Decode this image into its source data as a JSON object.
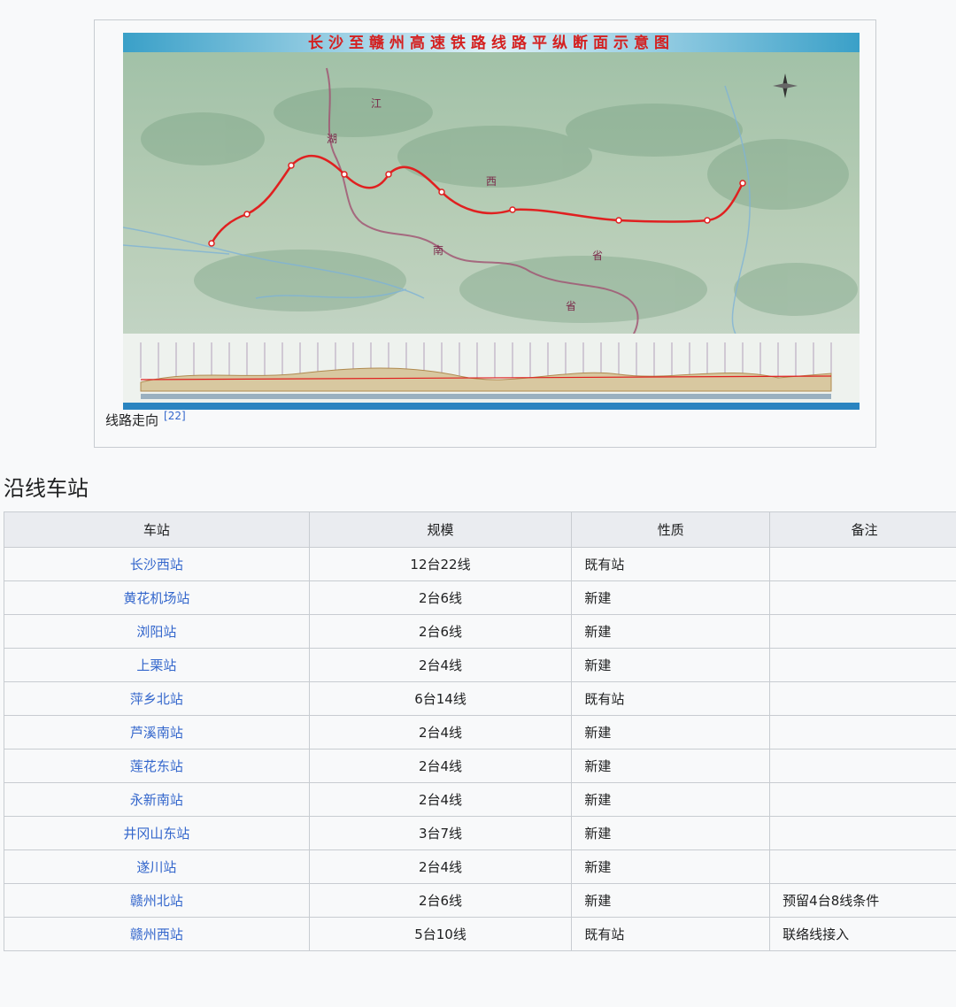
{
  "figure": {
    "map_title": "长沙至赣州高速铁路线路平纵断面示意图",
    "province_labels": [
      "江",
      "湖",
      "南",
      "西",
      "省",
      "省"
    ],
    "caption": "线路走向",
    "caption_ref": "[22]",
    "colors": {
      "route": "#e02020",
      "title": "#d42020",
      "border": "#a05070"
    }
  },
  "section": {
    "title": "沿线车站"
  },
  "table": {
    "headers": [
      "车站",
      "规模",
      "性质",
      "备注"
    ],
    "rows": [
      {
        "name": "长沙西站",
        "scale": "12台22线",
        "type": "既有站",
        "note": ""
      },
      {
        "name": "黄花机场站",
        "scale": "2台6线",
        "type": "新建",
        "note": ""
      },
      {
        "name": "浏阳站",
        "scale": "2台6线",
        "type": "新建",
        "note": ""
      },
      {
        "name": "上栗站",
        "scale": "2台4线",
        "type": "新建",
        "note": ""
      },
      {
        "name": "萍乡北站",
        "scale": "6台14线",
        "type": "既有站",
        "note": ""
      },
      {
        "name": "芦溪南站",
        "scale": "2台4线",
        "type": "新建",
        "note": ""
      },
      {
        "name": "莲花东站",
        "scale": "2台4线",
        "type": "新建",
        "note": ""
      },
      {
        "name": "永新南站",
        "scale": "2台4线",
        "type": "新建",
        "note": ""
      },
      {
        "name": "井冈山东站",
        "scale": "3台7线",
        "type": "新建",
        "note": ""
      },
      {
        "name": "遂川站",
        "scale": "2台4线",
        "type": "新建",
        "note": ""
      },
      {
        "name": "赣州北站",
        "scale": "2台6线",
        "type": "新建",
        "note": "预留4台8线条件"
      },
      {
        "name": "赣州西站",
        "scale": "5台10线",
        "type": "既有站",
        "note": "联络线接入"
      }
    ]
  }
}
